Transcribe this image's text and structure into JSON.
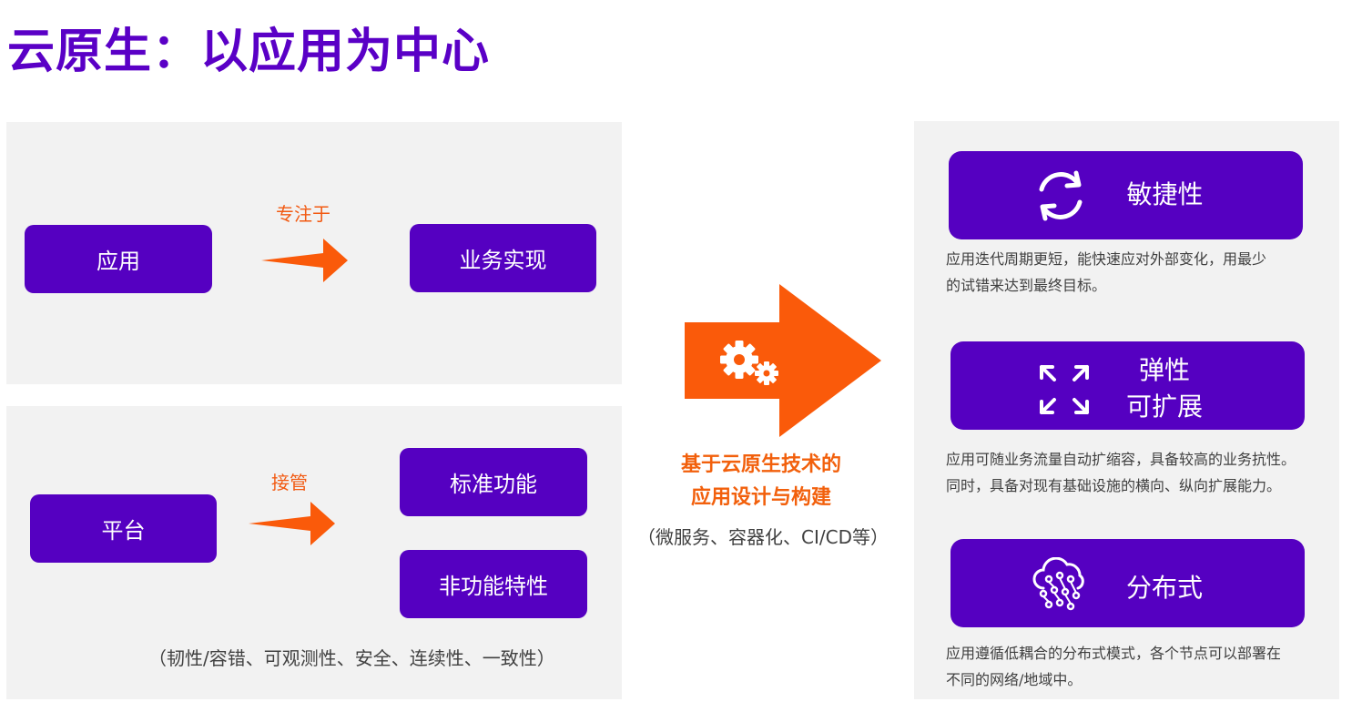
{
  "title": "云原生：以应用为中心",
  "left_top": {
    "app_label": "应用",
    "arrow_label": "专注于",
    "business_label": "业务实现"
  },
  "left_bottom": {
    "platform_label": "平台",
    "arrow_label": "接管",
    "standard_label": "标准功能",
    "nonfunctional_label": "非功能特性",
    "note": "（韧性/容错、可观测性、安全、连续性、一致性）"
  },
  "center": {
    "line1": "基于云原生技术的",
    "line2": "应用设计与构建",
    "sub": "（微服务、容器化、CI/CD等）"
  },
  "features": [
    {
      "label": "敏捷性",
      "icon": "refresh-icon",
      "desc1": "应用迭代周期更短，能快速应对外部变化，用最少",
      "desc2": "的试错来达到最终目标。"
    },
    {
      "label1": "弹性",
      "label2": "可扩展",
      "icon": "expand-arrows-icon",
      "desc1": "应用可随业务流量自动扩缩容，具备较高的业务抗性。",
      "desc2": "同时，具备对现有基础设施的横向、纵向扩展能力。"
    },
    {
      "label": "分布式",
      "icon": "cloud-network-icon",
      "desc1": "应用遵循低耦合的分布式模式，各个节点可以部署在",
      "desc2": "不同的网络/地域中。"
    }
  ],
  "colors": {
    "brand_purple": "#5500c1",
    "accent_orange": "#fa5a0a",
    "panel_gray": "#f2f2f2"
  }
}
